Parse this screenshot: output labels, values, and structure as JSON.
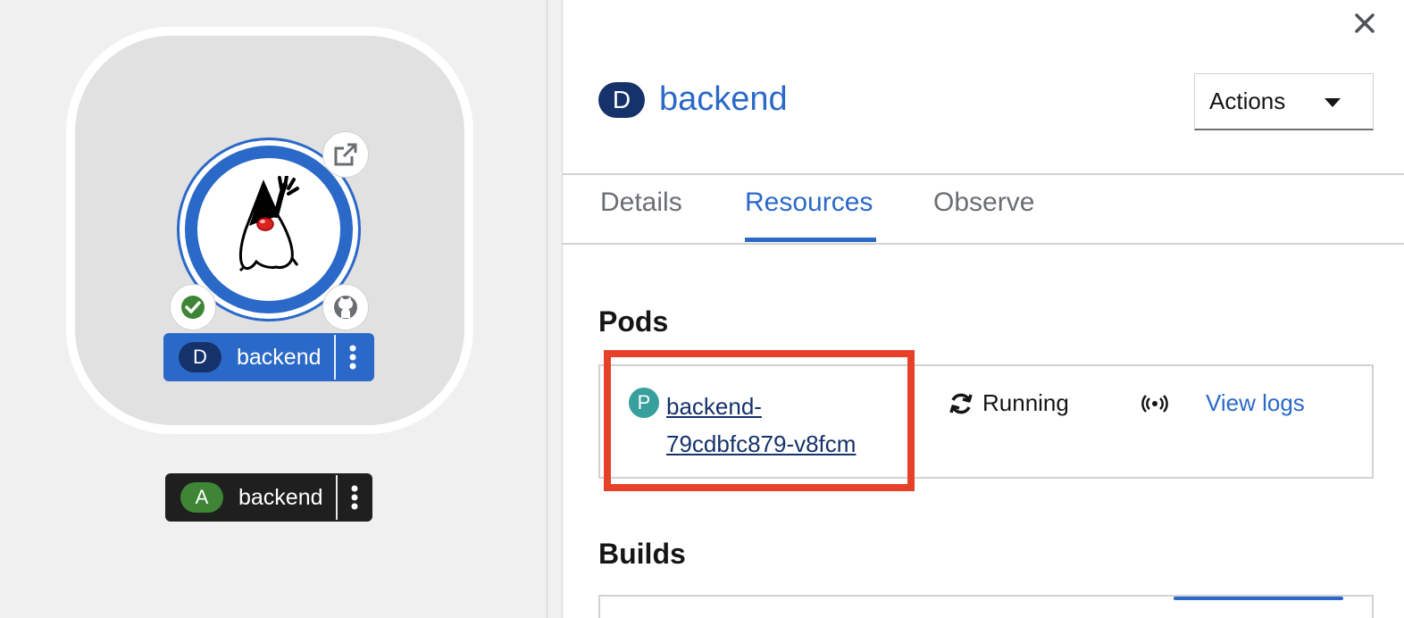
{
  "topology": {
    "deployment_label": {
      "badge": "D",
      "name": "backend"
    },
    "application_label": {
      "badge": "A",
      "name": "backend"
    }
  },
  "panel": {
    "title_badge": "D",
    "title": "backend",
    "actions_label": "Actions",
    "tabs": [
      {
        "label": "Details",
        "active": false
      },
      {
        "label": "Resources",
        "active": true
      },
      {
        "label": "Observe",
        "active": false
      }
    ],
    "pods_heading": "Pods",
    "pod": {
      "badge": "P",
      "name_line1": "backend-",
      "name_line2": "79cdbfc879-v8fcm",
      "status": "Running",
      "view_logs": "View logs"
    },
    "builds_heading": "Builds"
  },
  "colors": {
    "accent_blue": "#2b69c9",
    "deployment_badge": "#15326b",
    "pod_badge": "#38a09c",
    "app_badge": "#3e8635",
    "highlight": "#e8412a"
  },
  "icons": [
    "external-link-icon",
    "check-circle-icon",
    "github-icon",
    "duke-java-icon",
    "kebab-icon",
    "close-icon",
    "sync-icon",
    "signal-icon",
    "caret-down-icon"
  ]
}
